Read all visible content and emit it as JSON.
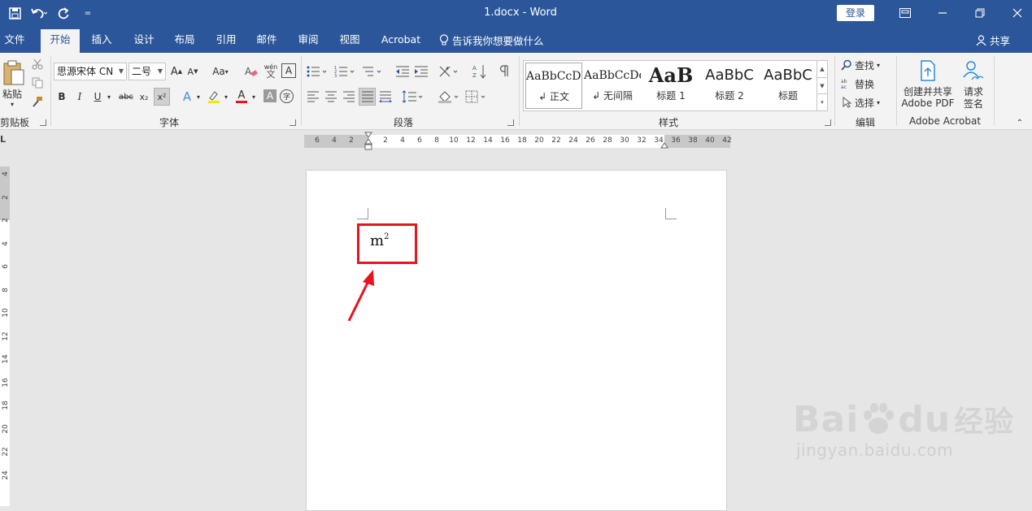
{
  "window": {
    "doc_title": "1.docx  -  Word",
    "login": "登录",
    "qat_customize": "="
  },
  "tabs": [
    {
      "label": "文件",
      "active": false
    },
    {
      "label": "开始",
      "active": true
    },
    {
      "label": "插入",
      "active": false
    },
    {
      "label": "设计",
      "active": false
    },
    {
      "label": "布局",
      "active": false
    },
    {
      "label": "引用",
      "active": false
    },
    {
      "label": "邮件",
      "active": false
    },
    {
      "label": "审阅",
      "active": false
    },
    {
      "label": "视图",
      "active": false
    },
    {
      "label": "Acrobat",
      "active": false
    }
  ],
  "tellme": "告诉我你想要做什么",
  "share": "共享",
  "ribbon": {
    "clipboard": {
      "paste": "粘贴",
      "label": "剪贴板"
    },
    "font": {
      "font_name": "思源宋体 CN",
      "font_size": "二号",
      "grow": "A",
      "shrink": "A",
      "case": "Aa",
      "phonetic": "wén",
      "border_char": "A",
      "bold": "B",
      "italic": "I",
      "underline": "U",
      "strike": "abc",
      "subscript": "x₂",
      "superscript": "x²",
      "effects": "A",
      "font_color": "A",
      "shading": "A",
      "enclose": "字",
      "label": "字体"
    },
    "paragraph": {
      "label": "段落"
    },
    "styles": {
      "items": [
        {
          "preview": "AaBbCcDd",
          "name": "↲ 正文"
        },
        {
          "preview": "AaBbCcDd",
          "name": "↲ 无间隔"
        },
        {
          "preview": "AaB",
          "name": "标题 1"
        },
        {
          "preview": "AaBbC",
          "name": "标题 2"
        },
        {
          "preview": "AaBbC",
          "name": "标题"
        }
      ],
      "label": "样式"
    },
    "editing": {
      "find": "查找",
      "replace": "替换",
      "select": "选择",
      "label": "编辑"
    },
    "acrobat": {
      "create_pdf": "创建并共享",
      "create_pdf2": "Adobe PDF",
      "sign": "请求",
      "sign2": "签名",
      "label": "Adobe Acrobat"
    }
  },
  "ruler": {
    "corner": "L",
    "h_ticks_left": [
      "6",
      "4",
      "2"
    ],
    "h_ticks": [
      "2",
      "4",
      "6",
      "8",
      "10",
      "12",
      "14",
      "16",
      "18",
      "20",
      "22",
      "24",
      "26",
      "28",
      "30",
      "32",
      "34",
      "36",
      "38",
      "40",
      "42"
    ],
    "v_ticks": [
      "4",
      "2",
      "2",
      "4",
      "6",
      "8",
      "10",
      "12",
      "14",
      "16",
      "18",
      "20",
      "22",
      "24"
    ]
  },
  "document": {
    "base": "m",
    "superscript": "2"
  },
  "watermark": {
    "brand": "Bai",
    "brand2": "du",
    "cn": "经验",
    "url": "jingyan.baidu.com"
  },
  "colors": {
    "accent": "#2b579a",
    "highlight": "#e8141f"
  }
}
